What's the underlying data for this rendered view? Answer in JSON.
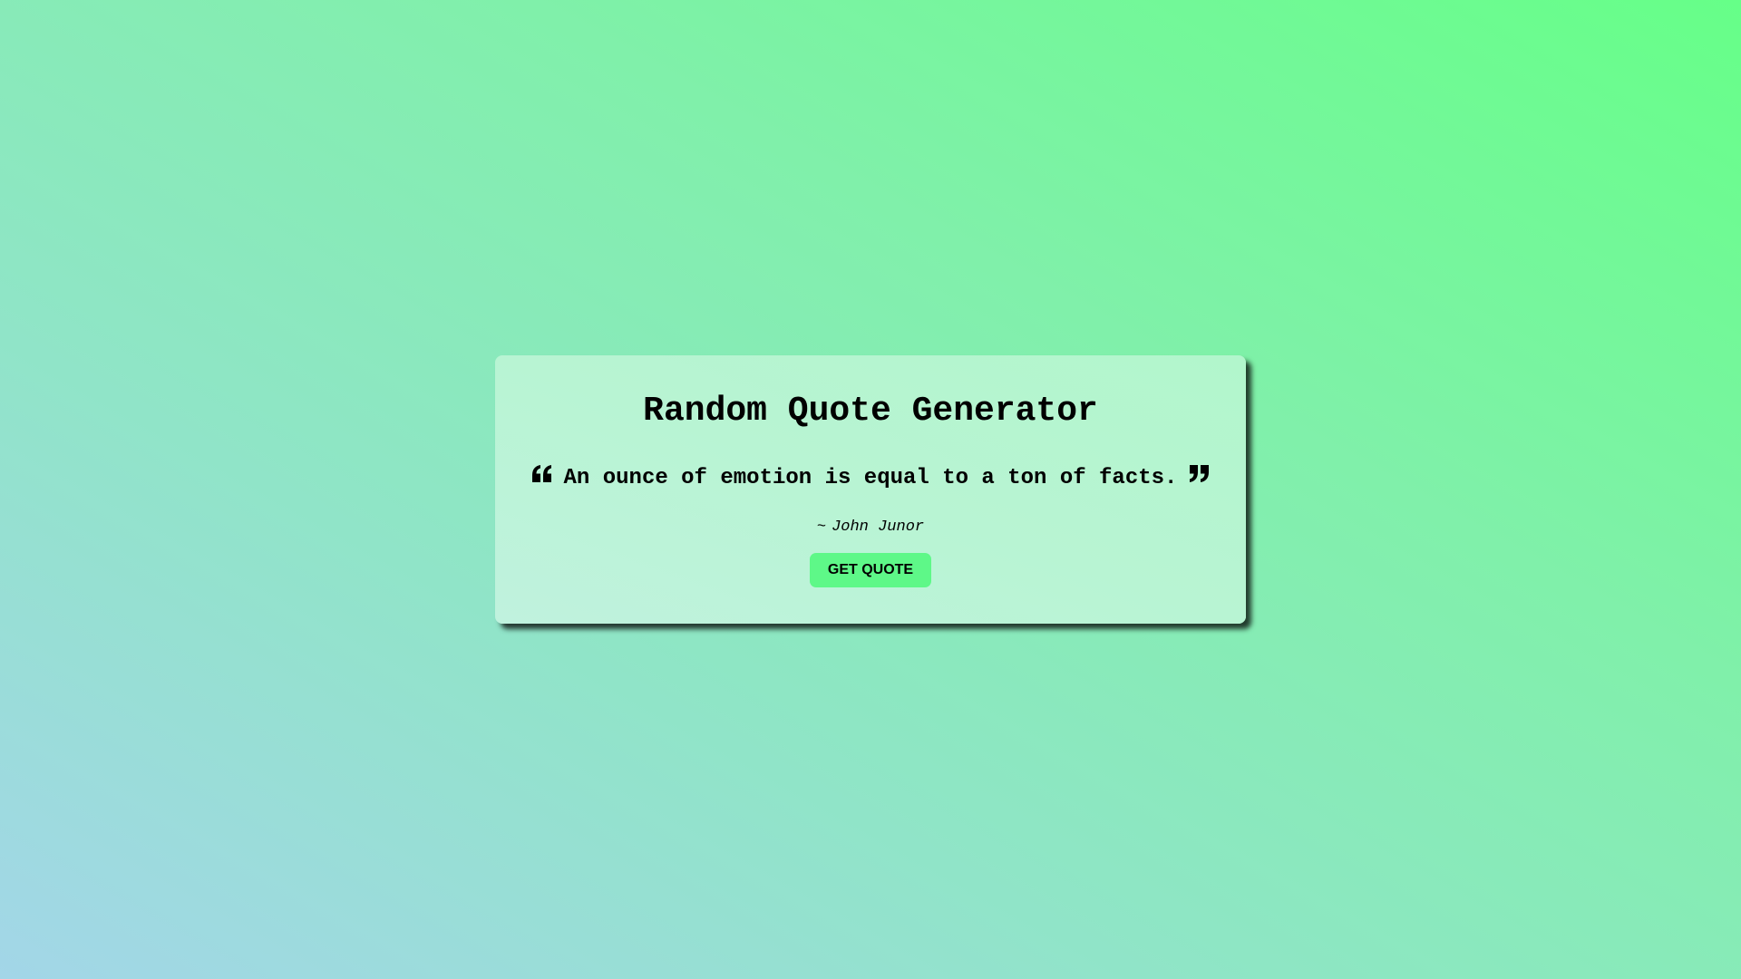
{
  "app": {
    "title": "Random Quote Generator"
  },
  "quote": {
    "text": "An ounce of emotion is equal to a ton of facts.",
    "open_icon": "quote-left-icon",
    "close_icon": "quote-right-icon",
    "author_prefix": "~",
    "author": "John Junor"
  },
  "actions": {
    "get_quote_label": "GET QUOTE"
  },
  "colors": {
    "button": "#5ef888",
    "text": "#000000"
  }
}
